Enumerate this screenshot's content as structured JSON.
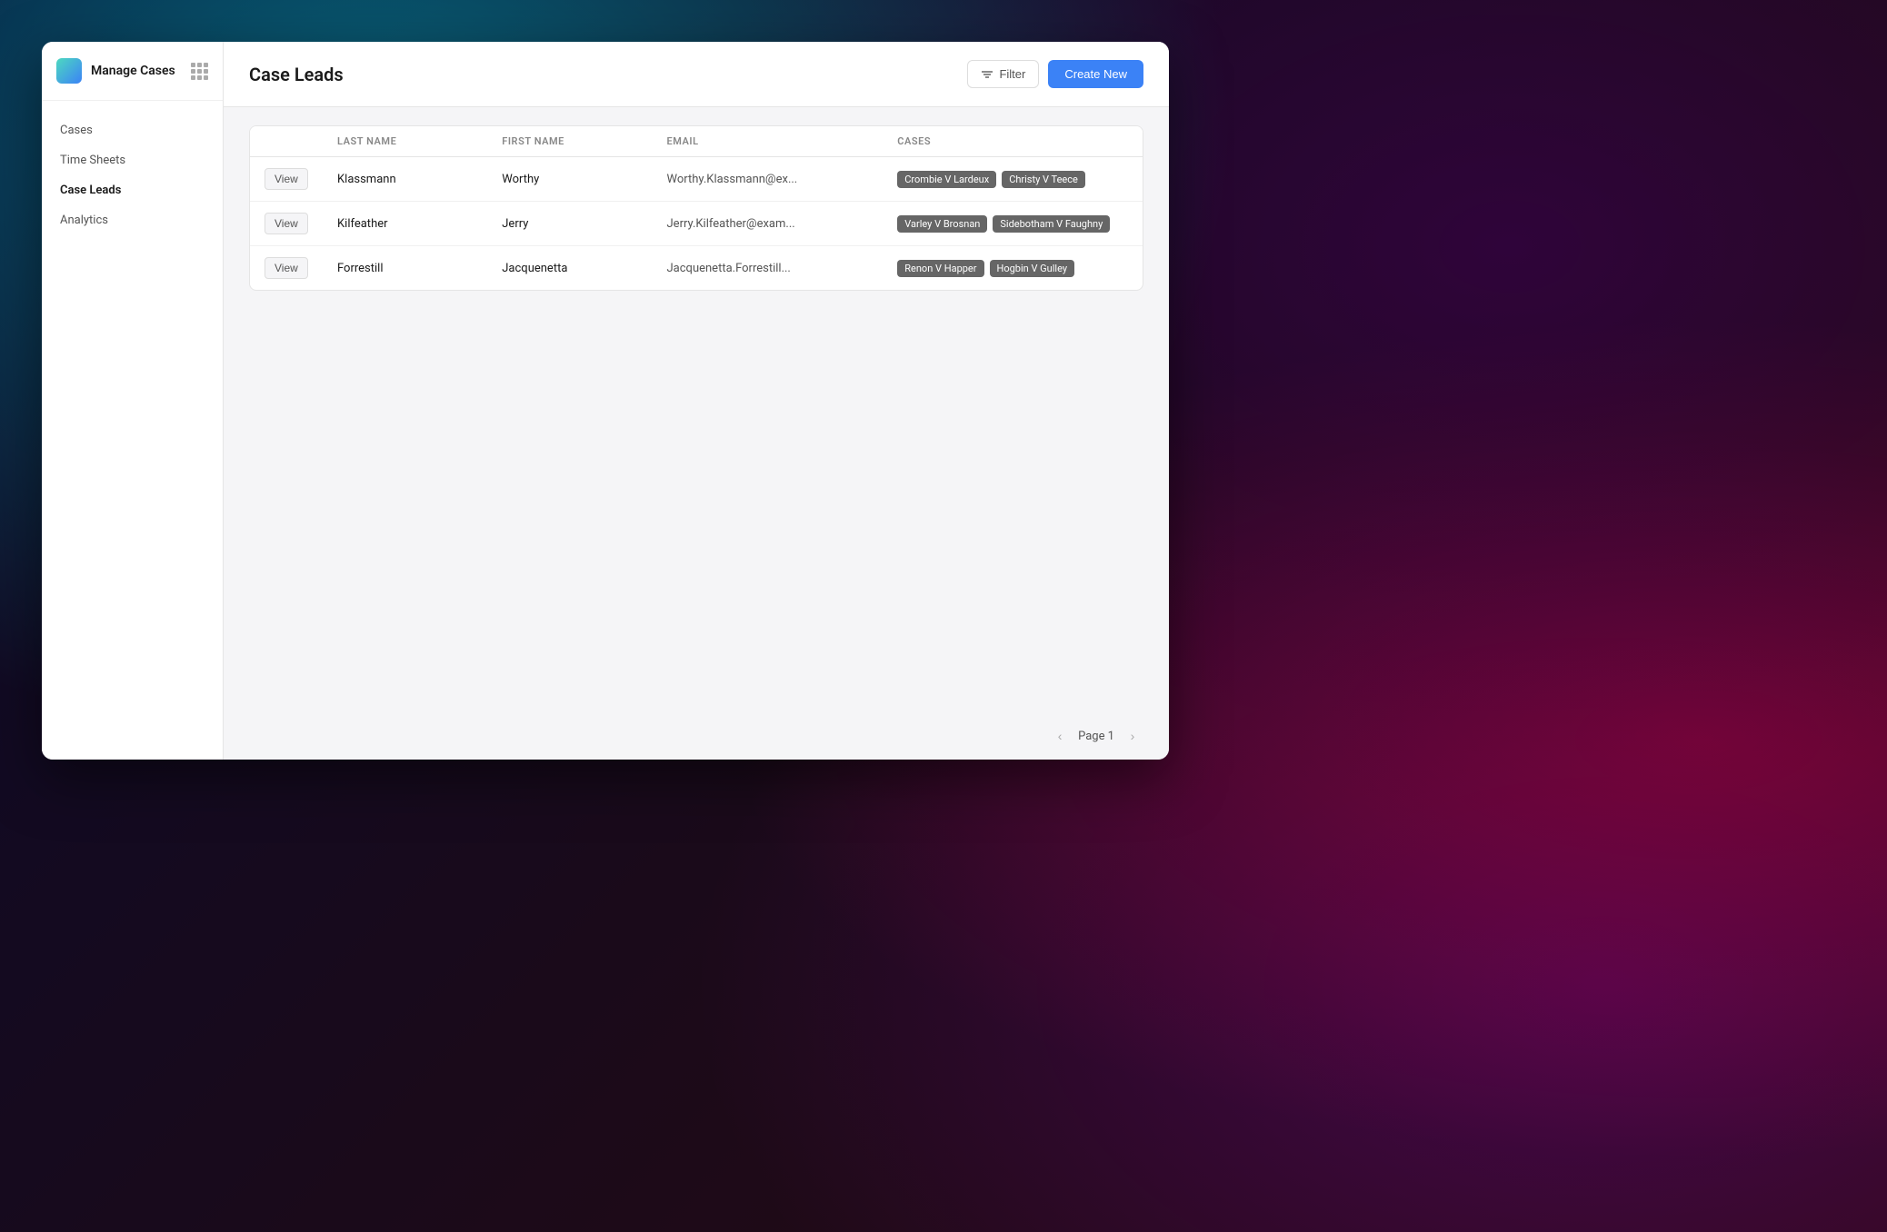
{
  "background": {
    "description": "macOS-style gradient background"
  },
  "sidebar": {
    "app_title": "Manage Cases",
    "nav_items": [
      {
        "id": "cases",
        "label": "Cases",
        "active": false
      },
      {
        "id": "time-sheets",
        "label": "Time Sheets",
        "active": false
      },
      {
        "id": "case-leads",
        "label": "Case Leads",
        "active": true
      },
      {
        "id": "analytics",
        "label": "Analytics",
        "active": false
      }
    ]
  },
  "topbar": {
    "title": "Case Leads",
    "filter_label": "Filter",
    "create_new_label": "Create New"
  },
  "table": {
    "columns": [
      {
        "id": "action",
        "label": ""
      },
      {
        "id": "last_name",
        "label": "Last Name"
      },
      {
        "id": "first_name",
        "label": "First Name"
      },
      {
        "id": "email",
        "label": "Email"
      },
      {
        "id": "cases",
        "label": "Cases"
      }
    ],
    "rows": [
      {
        "view_label": "View",
        "last_name": "Klassmann",
        "first_name": "Worthy",
        "email": "Worthy.Klassmann@ex...",
        "cases": [
          "Crombie V Lardeux",
          "Christy V Teece"
        ]
      },
      {
        "view_label": "View",
        "last_name": "Kilfeather",
        "first_name": "Jerry",
        "email": "Jerry.Kilfeather@exam...",
        "cases": [
          "Varley V Brosnan",
          "Sidebotham V Faughny"
        ]
      },
      {
        "view_label": "View",
        "last_name": "Forrestill",
        "first_name": "Jacquenetta",
        "email": "Jacquenetta.Forrestill...",
        "cases": [
          "Renon V Happer",
          "Hogbin V Gulley"
        ]
      }
    ]
  },
  "pagination": {
    "page_label": "Page 1"
  }
}
